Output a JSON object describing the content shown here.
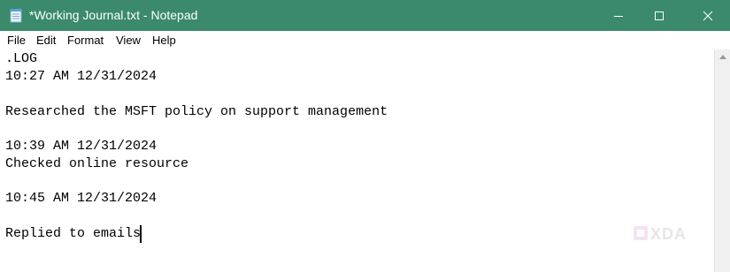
{
  "window": {
    "title": "*Working Journal.txt - Notepad",
    "titlebar_color": "#3a8a6b",
    "icons": {
      "app": "notepad-icon",
      "minimize": "minimize-icon",
      "maximize": "maximize-icon",
      "close": "close-icon"
    }
  },
  "menu": {
    "items": [
      {
        "label": "File"
      },
      {
        "label": "Edit"
      },
      {
        "label": "Format"
      },
      {
        "label": "View"
      },
      {
        "label": "Help"
      }
    ]
  },
  "editor": {
    "lines": [
      ".LOG",
      "10:27 AM 12/31/2024",
      "",
      "Researched the MSFT policy on support management",
      "",
      "10:39 AM 12/31/2024",
      "Checked online resource",
      "",
      "10:45 AM 12/31/2024",
      "",
      "Replied to emails"
    ]
  },
  "watermark": {
    "logo": "xda-logo",
    "text": "XDA"
  }
}
